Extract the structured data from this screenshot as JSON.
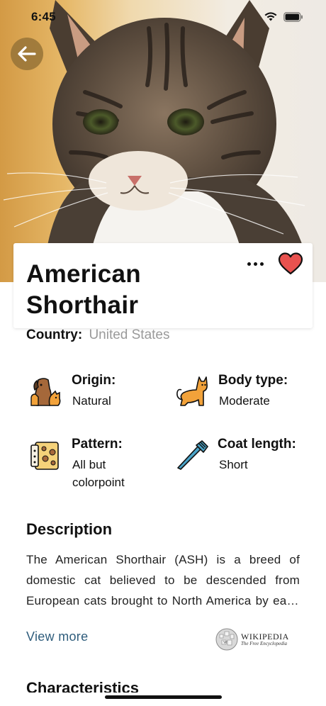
{
  "status_bar": {
    "time": "6:45"
  },
  "breed": {
    "name": "American Shorthair",
    "country_label": "Country:",
    "country_value": "United States"
  },
  "attributes": [
    {
      "label": "Origin:",
      "value": "Natural",
      "icon": "dog-and-cat-icon"
    },
    {
      "label": "Body type:",
      "value": "Moderate",
      "icon": "cat-silhouette-icon"
    },
    {
      "label": "Pattern:",
      "value": "All but colorpoint",
      "icon": "pattern-swatch-icon"
    },
    {
      "label": "Coat length:",
      "value": "Short",
      "icon": "comb-icon"
    }
  ],
  "description": {
    "heading": "Description",
    "text": "The American Shorthair (ASH) is a breed of domestic cat believed to be descended from European cats brought to North America by early settlers to protect valuable cargo from mice and rats.",
    "view_more": "View more",
    "source_name": "WIKIPEDIA",
    "source_tagline": "The Free Encyclopedia"
  },
  "characteristics": {
    "heading": "Characteristics"
  },
  "colors": {
    "accent_link": "#2f5d7c",
    "heart": "#e8524f",
    "back_button": "#96733a"
  }
}
